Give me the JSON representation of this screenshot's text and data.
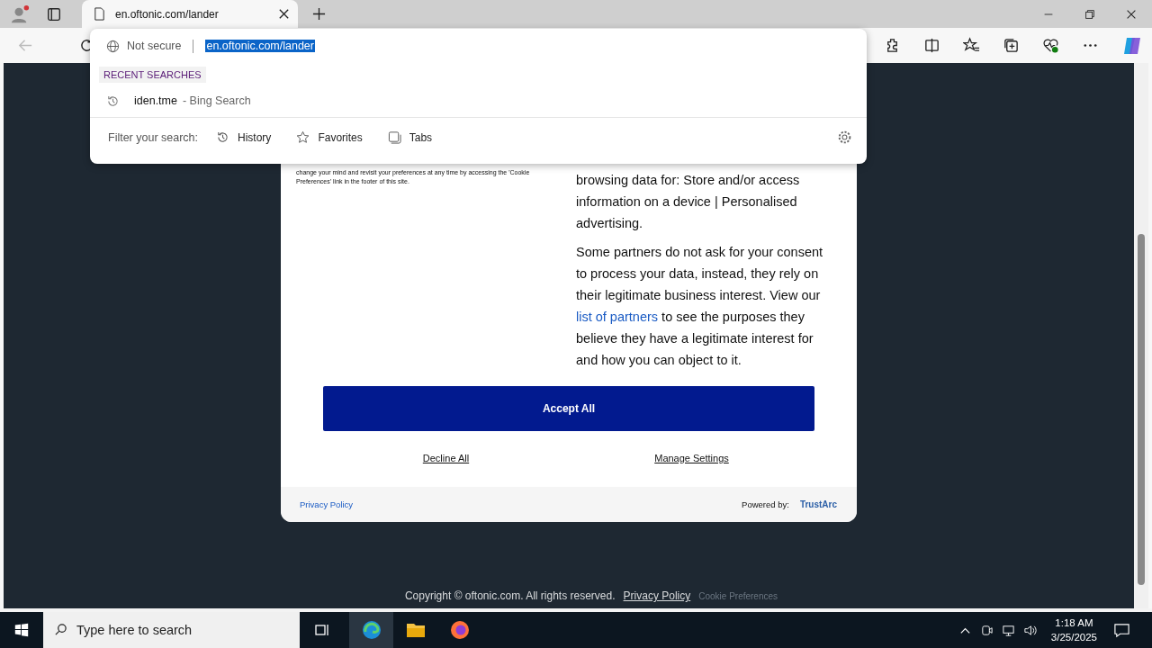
{
  "browser": {
    "tab": {
      "title": "en.oftonic.com/lander"
    },
    "address": {
      "security": "Not secure",
      "url": "en.oftonic.com/lander"
    }
  },
  "dropdown": {
    "heading": "RECENT SEARCHES",
    "items": [
      {
        "query": "iden.tme",
        "source": "- Bing Search"
      }
    ],
    "filter_label": "Filter your search:",
    "filters": [
      {
        "label": "History",
        "kind": "history"
      },
      {
        "label": "Favorites",
        "kind": "star"
      },
      {
        "label": "Tabs",
        "kind": "tabs"
      }
    ]
  },
  "consent": {
    "left_text": "change your mind and revisit your preferences at any time by accessing the 'Cookie Preferences' link in the footer of this site.",
    "right_text": "browsing data for: Store and/or access information on a device | Personalised advertising.",
    "partners_before": "Some partners do not ask for your consent to process your data, instead, they rely on their legitimate business interest. View our ",
    "partners_link": "list of partners",
    "partners_after": " to see the purposes they believe they have a legitimate interest for and how you can object to it.",
    "accept": "Accept All",
    "decline": "Decline All",
    "manage": "Manage Settings",
    "privacy": "Privacy Policy",
    "powered_by": "Powered by:",
    "brand": "TrustArc"
  },
  "page_footer": {
    "copyright": "Copyright © oftonic.com.  All rights reserved.",
    "privacy": "Privacy Policy",
    "cookie": "Cookie Preferences"
  },
  "taskbar": {
    "search_placeholder": "Type here to search",
    "time": "1:18 AM",
    "date": "3/25/2025"
  }
}
